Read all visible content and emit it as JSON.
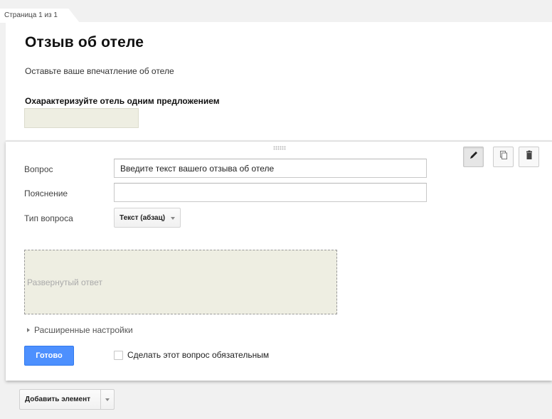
{
  "page_tab": {
    "label": "Страница 1 из 1"
  },
  "form": {
    "title": "Отзыв об отеле",
    "description": "Оставьте ваше впечатление об отеле"
  },
  "question1": {
    "title": "Охарактеризуйте отель одним предложением"
  },
  "editor": {
    "toolbar": {
      "edit_icon": "pencil-icon",
      "copy_icon": "copy-icon",
      "delete_icon": "trash-icon"
    },
    "question_label": "Вопрос",
    "question_value": "Введите текст вашего отзыва об отеле",
    "hint_label": "Пояснение",
    "hint_value": "",
    "type_label": "Тип вопроса",
    "type_value": "Текст (абзац)",
    "preview_label": "Развернутый ответ",
    "advanced_label": "Расширенные настройки",
    "done_label": "Готово",
    "required_label": "Сделать этот вопрос обязательным",
    "required_checked": false
  },
  "add_item": {
    "label": "Добавить элемент"
  },
  "colors": {
    "primary_button": "#4d90fe",
    "answer_field": "#eeeee2",
    "background": "#f1f1f1"
  }
}
